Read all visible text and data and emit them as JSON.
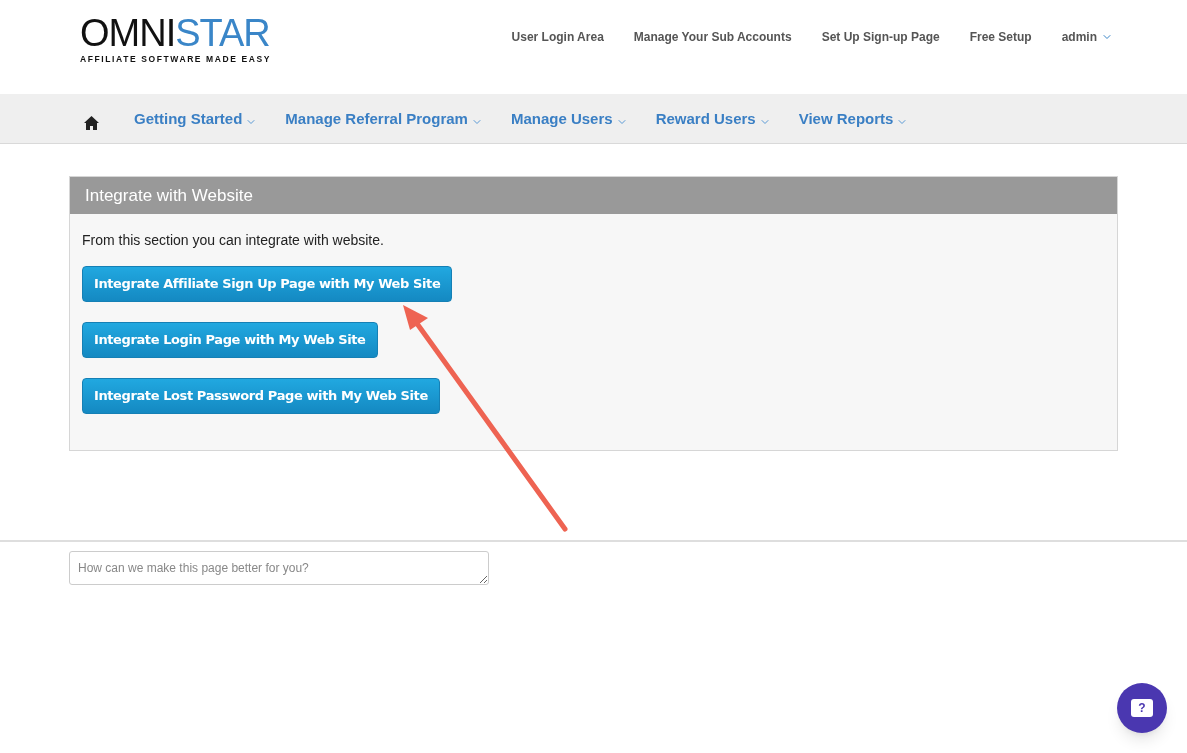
{
  "logo": {
    "word_dark": "OMNI",
    "word_accent": "STAR",
    "tagline": "AFFILIATE SOFTWARE MADE EASY"
  },
  "top_links": [
    {
      "label": "User Login Area",
      "dropdown": false
    },
    {
      "label": "Manage Your Sub Accounts",
      "dropdown": false
    },
    {
      "label": "Set Up Sign-up Page",
      "dropdown": false
    },
    {
      "label": "Free Setup",
      "dropdown": false
    },
    {
      "label": "admin",
      "dropdown": true
    }
  ],
  "nav_menu": [
    {
      "label": "Getting Started"
    },
    {
      "label": "Manage Referral Program"
    },
    {
      "label": "Manage Users"
    },
    {
      "label": "Reward Users"
    },
    {
      "label": "View Reports"
    }
  ],
  "panel": {
    "title": "Integrate with Website",
    "description": "From this section you can integrate with website.",
    "buttons": [
      "Integrate Affiliate Sign Up Page with My Web Site",
      "Integrate Login Page with My Web Site",
      "Integrate Lost Password Page with My Web Site"
    ]
  },
  "feedback": {
    "placeholder": "How can we make this page better for you?"
  },
  "help_button": {
    "label": "?"
  }
}
